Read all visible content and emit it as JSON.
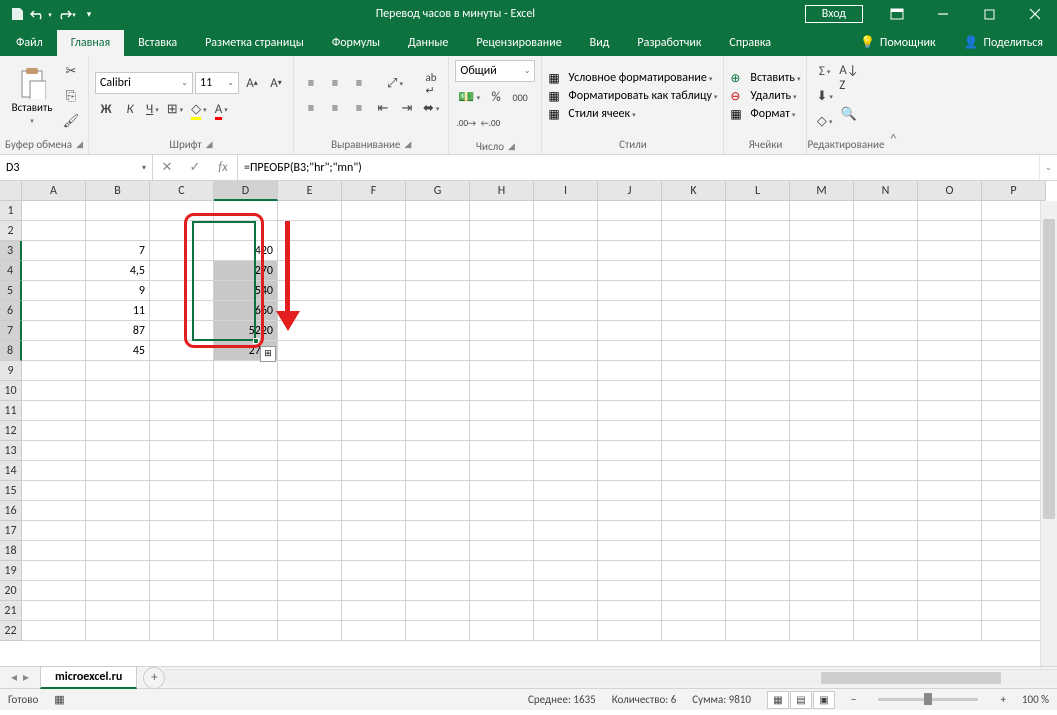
{
  "titlebar": {
    "title": "Перевод часов в минуты  -  Excel",
    "login": "Вход"
  },
  "tabs": {
    "file": "Файл",
    "home": "Главная",
    "insert": "Вставка",
    "layout": "Разметка страницы",
    "formulas": "Формулы",
    "data": "Данные",
    "review": "Рецензирование",
    "view": "Вид",
    "developer": "Разработчик",
    "help": "Справка",
    "tellme": "Помощник",
    "share": "Поделиться"
  },
  "ribbon": {
    "clipboard": {
      "paste": "Вставить",
      "label": "Буфер обмена"
    },
    "font": {
      "name": "Calibri",
      "size": "11",
      "label": "Шрифт",
      "bold": "Ж",
      "italic": "К",
      "underline": "Ч"
    },
    "align": {
      "label": "Выравнивание"
    },
    "number": {
      "format": "Общий",
      "label": "Число"
    },
    "styles": {
      "condfmt": "Условное форматирование",
      "table": "Форматировать как таблицу",
      "cell": "Стили ячеек",
      "label": "Стили"
    },
    "cells": {
      "insert": "Вставить",
      "delete": "Удалить",
      "format": "Формат",
      "label": "Ячейки"
    },
    "editing": {
      "label": "Редактирование"
    }
  },
  "namebox": "D3",
  "formula": "=ПРЕОБР(B3;\"hr\";\"mn\")",
  "columns": [
    "A",
    "B",
    "C",
    "D",
    "E",
    "F",
    "G",
    "H",
    "I",
    "J",
    "K",
    "L",
    "M",
    "N",
    "O",
    "P"
  ],
  "rows": [
    "1",
    "2",
    "3",
    "4",
    "5",
    "6",
    "7",
    "8",
    "9",
    "10",
    "11",
    "12",
    "13",
    "14",
    "15",
    "16",
    "17",
    "18",
    "19",
    "20",
    "21",
    "22"
  ],
  "data": {
    "B": {
      "3": "7",
      "4": "4,5",
      "5": "9",
      "6": "11",
      "7": "87",
      "8": "45"
    },
    "D": {
      "3": "420",
      "4": "270",
      "5": "540",
      "6": "660",
      "7": "5220",
      "8": "2700"
    }
  },
  "sheet": "microexcel.ru",
  "status": {
    "ready": "Готово",
    "avg": "Среднее: 1635",
    "count": "Количество: 6",
    "sum": "Сумма: 9810",
    "zoom": "100 %"
  }
}
